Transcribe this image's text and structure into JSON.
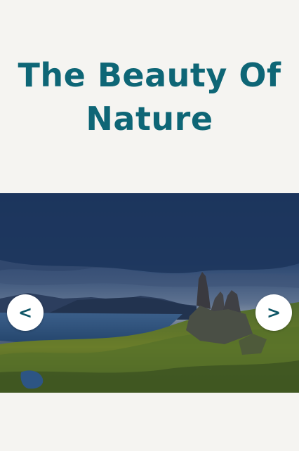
{
  "page": {
    "title": "The Beauty Of Nature",
    "background": "#f5f4f1",
    "accent": "#0e6676"
  },
  "slider": {
    "image_description_icon": "landscape-photo",
    "prev_label": "<",
    "next_label": ">"
  }
}
